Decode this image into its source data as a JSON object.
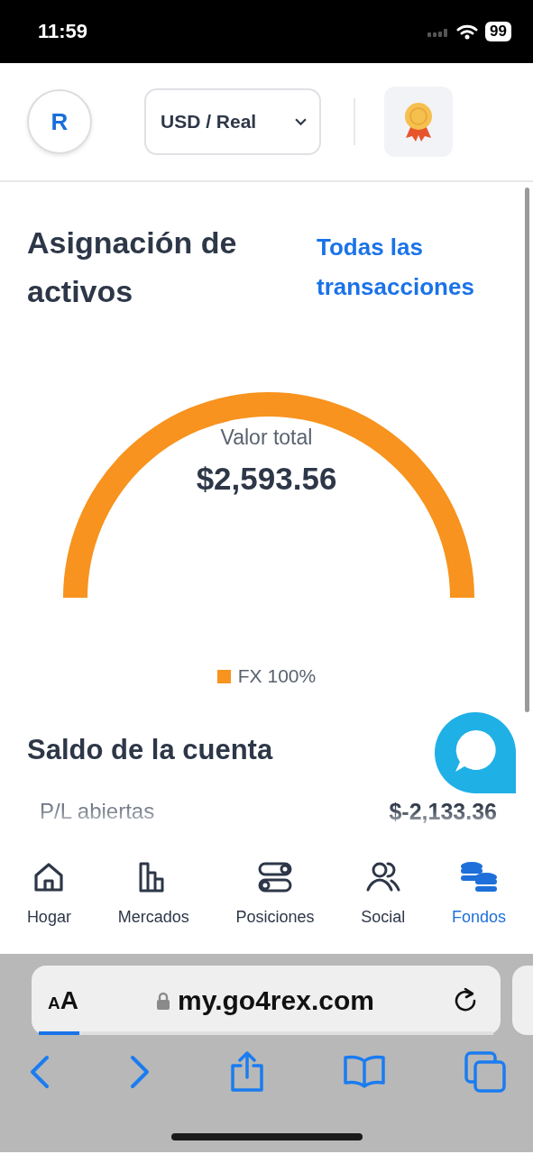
{
  "status_bar": {
    "time": "11:59",
    "battery": "99"
  },
  "header": {
    "avatar": "R",
    "account_select": {
      "value": "USD / Real"
    }
  },
  "allocation": {
    "title": "Asignación de activos",
    "link": "Todas las transacciones",
    "center_label": "Valor total",
    "center_value": "$2,593.56",
    "legend": [
      {
        "label": "FX 100%",
        "color": "#f7931e"
      }
    ]
  },
  "balance": {
    "title": "Saldo de la cuenta",
    "rows": [
      {
        "label": "P/L abiertas",
        "value": "$-2,133.36"
      }
    ]
  },
  "nav": [
    {
      "label": "Hogar",
      "kind": "home",
      "selected": false
    },
    {
      "label": "Mercados",
      "kind": "markets",
      "selected": false
    },
    {
      "label": "Posiciones",
      "kind": "positions",
      "selected": false
    },
    {
      "label": "Social",
      "kind": "social",
      "selected": false
    },
    {
      "label": "Fondos",
      "kind": "funds",
      "selected": true
    }
  ],
  "browser": {
    "text_size": "AA",
    "url": "my.go4rex.com",
    "level": 0.09
  }
}
